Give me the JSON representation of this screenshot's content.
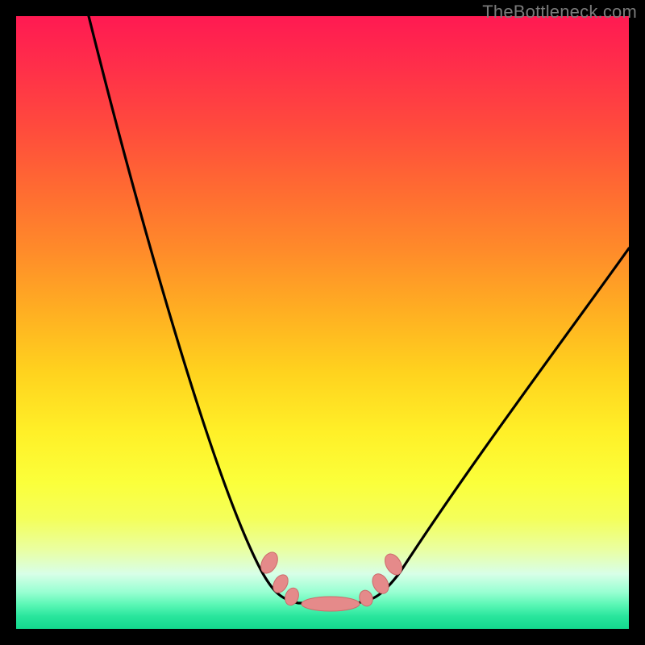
{
  "watermark": "TheBottleneck.com",
  "colors": {
    "frame": "#000000",
    "gradient_top": "#ff1a52",
    "gradient_mid": "#ffd21e",
    "gradient_bottom": "#14d98e",
    "curve": "#000000",
    "marker_fill": "#e58a8a",
    "marker_stroke": "#cc6b6b"
  },
  "chart_data": {
    "type": "line",
    "title": "",
    "xlabel": "",
    "ylabel": "",
    "x_range": [
      0,
      100
    ],
    "y_range": [
      0,
      100
    ],
    "note": "Axes are unlabeled; x/y expressed as percent of plot area (0=left/bottom, 100=right/top).",
    "curve": {
      "name": "bottleneck-curve",
      "left_branch": {
        "start": {
          "x": 12,
          "y": 100
        },
        "end": {
          "x": 42,
          "y": 4
        }
      },
      "valley": {
        "start": {
          "x": 42,
          "y": 4
        },
        "end": {
          "x": 58,
          "y": 4
        }
      },
      "right_branch": {
        "start": {
          "x": 58,
          "y": 4
        },
        "end": {
          "x": 100,
          "y": 62
        }
      }
    },
    "markers": [
      {
        "x": 41.5,
        "y": 10.5,
        "r": 1.3
      },
      {
        "x": 43.0,
        "y": 7.0,
        "r": 1.3
      },
      {
        "x": 44.5,
        "y": 5.3,
        "r": 1.3
      },
      {
        "x": 50.0,
        "y": 4.3,
        "r": 1.3,
        "elongated": true
      },
      {
        "x": 56.0,
        "y": 5.3,
        "r": 1.3
      },
      {
        "x": 58.5,
        "y": 7.8,
        "r": 1.3
      },
      {
        "x": 60.5,
        "y": 11.0,
        "r": 1.3
      }
    ]
  }
}
